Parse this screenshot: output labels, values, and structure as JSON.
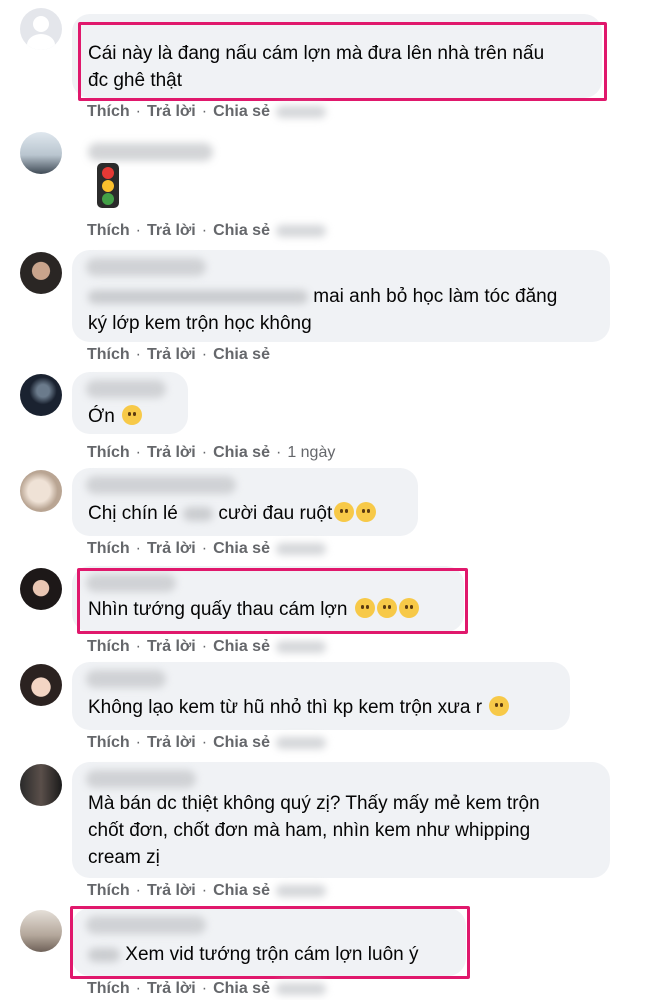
{
  "actions": {
    "like": "Thích",
    "reply": "Trả lời",
    "share": "Chia sẻ",
    "separator": "·"
  },
  "comments": [
    {
      "avatar": "default-avatar",
      "text": "Cái này là đang nấu cám lợn mà đưa lên nhà trên nấu\nđc ghê thật",
      "time": ""
    },
    {
      "avatar": "photo-avatar",
      "sticker": "traffic-light-emoji",
      "text": "",
      "time": ""
    },
    {
      "avatar": "photo-avatar",
      "text": "mai anh bỏ học làm tóc đăng\nký lớp kem trộn học không",
      "time": ""
    },
    {
      "avatar": "photo-avatar",
      "text": "Ớn",
      "time": "1 ngày"
    },
    {
      "avatar": "photo-avatar",
      "text_a": "Chị chín lé",
      "text_b": "cười đau ruột",
      "time": ""
    },
    {
      "avatar": "photo-avatar",
      "text": "Nhìn tướng quấy thau cám lợn",
      "time": ""
    },
    {
      "avatar": "photo-avatar",
      "text": "Không lạo kem từ hũ nhỏ thì kp kem trộn xưa r",
      "time": ""
    },
    {
      "avatar": "photo-avatar",
      "text": "Mà bán dc thiệt không quý zị? Thấy mấy mẻ kem trộn\nchốt đơn, chốt đơn mà ham, nhìn kem như whipping\ncream zị",
      "time": ""
    },
    {
      "avatar": "photo-avatar",
      "text": "Xem vid tướng trộn cám lợn luôn ý",
      "time": ""
    }
  ],
  "colors": {
    "highlight": "#e0186c",
    "bubble": "#f0f2f5",
    "action_text": "#65676b"
  }
}
